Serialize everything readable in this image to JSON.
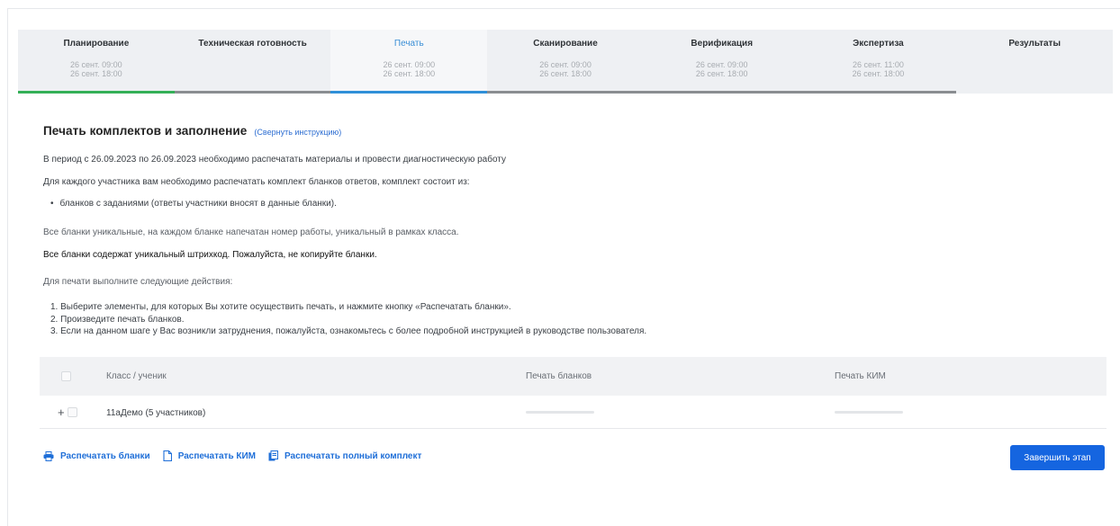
{
  "stages": [
    {
      "name": "Планирование",
      "date_start": "26 сент. 09:00",
      "date_end": "26 сент. 18:00",
      "status": "done"
    },
    {
      "name": "Техническая готовность",
      "date_start": "",
      "date_end": "",
      "status": "pending"
    },
    {
      "name": "Печать",
      "date_start": "26 сент. 09:00",
      "date_end": "26 сент. 18:00",
      "status": "active"
    },
    {
      "name": "Сканирование",
      "date_start": "26 сент. 09:00",
      "date_end": "26 сент. 18:00",
      "status": "pending"
    },
    {
      "name": "Верификация",
      "date_start": "26 сент. 09:00",
      "date_end": "26 сент. 18:00",
      "status": "pending"
    },
    {
      "name": "Экспертиза",
      "date_start": "26 сент. 11:00",
      "date_end": "26 сент. 18:00",
      "status": "pending"
    },
    {
      "name": "Результаты",
      "date_start": "",
      "date_end": "",
      "status": "pending"
    }
  ],
  "instructions": {
    "title": "Печать комплектов и заполнение",
    "collapse_link": "(Свернуть инструкцию)",
    "period_text": "В период с 26.09.2023 по 26.09.2023 необходимо распечатать материалы и провести диагностическую работу",
    "kit_text": "Для каждого участника вам необходимо распечатать комплект бланков ответов, комплект состоит из:",
    "bullet": "бланков с заданиями (ответы участники вносят в данные бланки).",
    "unique_text": "Все бланки уникальные, на каждом бланке напечатан номер работы, уникальный в рамках класса.",
    "barcode_text": "Все бланки содержат уникальный штрихкод. Пожалуйста, не копируйте бланки.",
    "steps_intro": "Для печати выполните следующие действия:",
    "steps": [
      "1. Выберите элементы, для которых Вы хотите осуществить печать, и нажмите кнопку «Распечатать бланки».",
      "2. Произведите печать бланков.",
      "3. Если на данном шаге у Вас возникли затруднения, пожалуйста, ознакомьтесь с более подробной инструкцией в руководстве пользователя."
    ]
  },
  "table": {
    "headers": {
      "class": "Класс / ученик",
      "print_forms": "Печать бланков",
      "print_kim": "Печать КИМ"
    },
    "rows": [
      {
        "expand": "+",
        "name": "11аДемо (5 участников)"
      }
    ]
  },
  "actions": {
    "print_forms": "Распечатать бланки",
    "print_kim": "Распечатать КИМ",
    "print_full": "Распечатать полный комплект"
  },
  "finish_button": "Завершить этап",
  "colors": {
    "accent": "#1565e0",
    "stage_done": "#34b057",
    "stage_active": "#2f8fd8",
    "stage_pending": "#8a8d91"
  }
}
